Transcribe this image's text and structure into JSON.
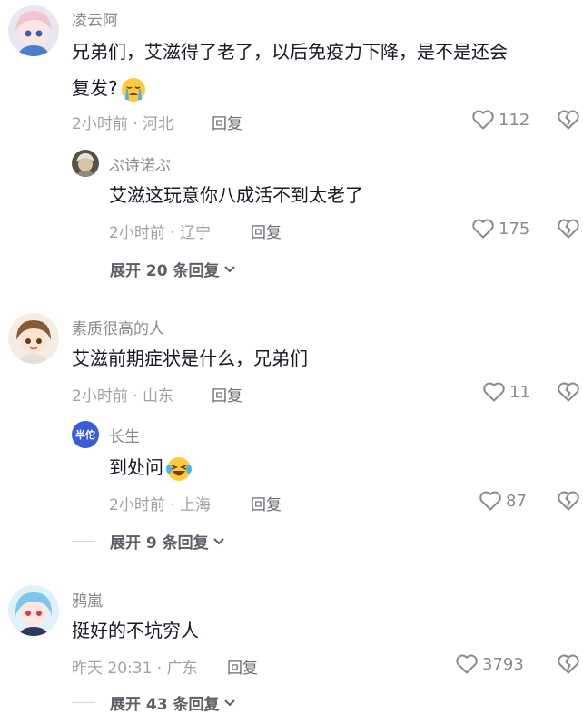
{
  "comments": [
    {
      "username": "凌云阿",
      "text_line1": "兄弟们，艾滋得了老了，以后免疫力下降，是不是还会",
      "text_line2": "复发?",
      "emoji": "crying-face-emoji",
      "time_location": "2小时前 · 河北",
      "reply_label": "回复",
      "likes": "112",
      "reply": {
        "username": "ぷ诗诺ぷ",
        "text": "艾滋这玩意你八成活不到太老了",
        "time_location": "2小时前 · 辽宁",
        "reply_label": "回复",
        "likes": "175"
      },
      "expand_label": "展开 20 条回复"
    },
    {
      "username": "素质很高的人",
      "text": "艾滋前期症状是什么，兄弟们",
      "time_location": "2小时前 · 山东",
      "reply_label": "回复",
      "likes": "11",
      "reply": {
        "username": "长生",
        "avatar_text": "半佗",
        "text": "到处问",
        "emoji": "laughing-crying-emoji",
        "time_location": "2小时前 · 上海",
        "reply_label": "回复",
        "likes": "87"
      },
      "expand_label": "展开 9 条回复"
    },
    {
      "username": "鸦嵐",
      "text": "挺好的不坑穷人",
      "time_location": "昨天 20:31 · 广东",
      "reply_label": "回复",
      "likes": "3793",
      "expand_label": "展开 43 条回复"
    }
  ],
  "colors": {
    "text": "#161823",
    "muted": "#8a8b91",
    "meta": "#a1a2a7",
    "avatar_blue": "#3b5bd9"
  },
  "icons": {
    "like": "heart-outline-icon",
    "dislike": "broken-heart-icon",
    "expand": "chevron-down-icon"
  }
}
